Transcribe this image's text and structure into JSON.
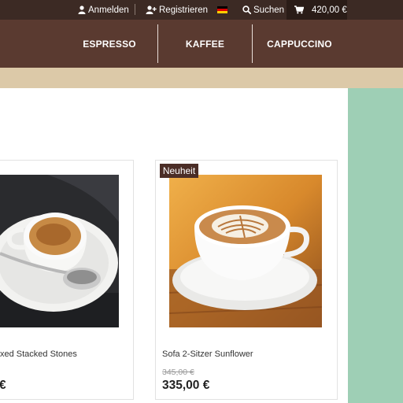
{
  "topbar": {
    "login_label": "Anmelden",
    "register_label": "Registrieren",
    "language_flag": "de-flag",
    "search_label": "Suchen",
    "cart_total": "420,00 €"
  },
  "nav": {
    "items": [
      {
        "label": "ESPRESSO"
      },
      {
        "label": "KAFFEE"
      },
      {
        "label": "CAPPUCCINO"
      }
    ]
  },
  "colors": {
    "topbar": "#3c2a24",
    "nav": "#5a3a30",
    "beige_band": "#dcc9a8",
    "side_panel": "#9ecfb5",
    "badge": "#4b2e27"
  },
  "products": [
    {
      "name_visible": "xed Stacked Stones",
      "price_visible": "€"
    },
    {
      "badge": "Neuheit",
      "name": "Sofa 2-Sitzer Sunflower",
      "old_price": "345,00 €",
      "price": "335,00 €"
    }
  ]
}
